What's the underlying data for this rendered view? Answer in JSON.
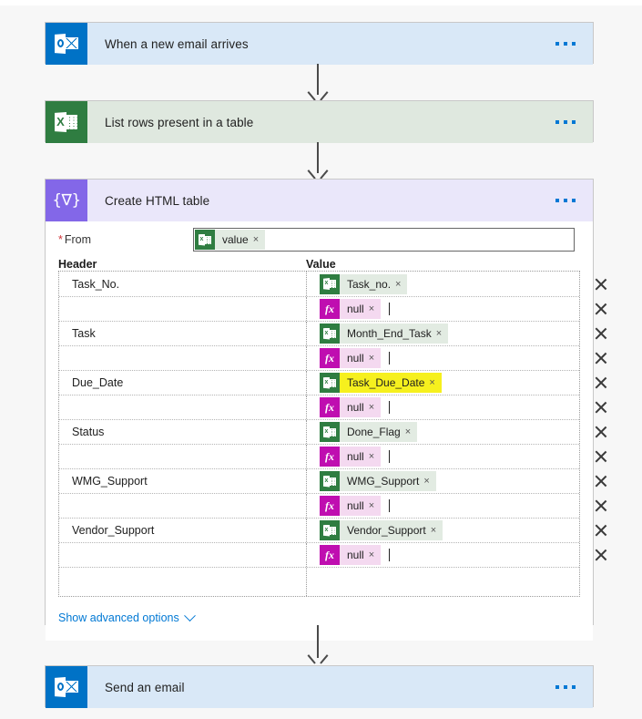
{
  "flow": {
    "steps": [
      {
        "id": "trigger",
        "title": "When a new email arrives",
        "icon": "outlook-icon",
        "theme": "outlook",
        "menu": "more-commands"
      },
      {
        "id": "list-rows",
        "title": "List rows present in a table",
        "icon": "excel-icon",
        "theme": "excel",
        "menu": "more-commands"
      },
      {
        "id": "create-html-table",
        "title": "Create HTML table",
        "icon": "data-operations-icon",
        "theme": "data",
        "menu": "more-commands"
      },
      {
        "id": "send-email",
        "title": "Send an email",
        "icon": "outlook-icon",
        "theme": "outlook",
        "menu": "more-commands"
      }
    ]
  },
  "create_html_table": {
    "from": {
      "label": "From",
      "required_marker": "*",
      "token": {
        "text": "value",
        "type": "excel",
        "remove": "×"
      }
    },
    "columns": {
      "header_label": "Header",
      "value_label": "Value"
    },
    "rows": [
      {
        "header": "Task_No.",
        "value": "Task_no.",
        "token_type": "excel",
        "highlighted": false,
        "remove": "×",
        "delete": "delete-row"
      },
      {
        "header": "",
        "value": "null",
        "token_type": "fx",
        "highlighted": false,
        "remove": "×",
        "delete": "delete-row"
      },
      {
        "header": "Task",
        "value": "Month_End_Task",
        "token_type": "excel",
        "highlighted": false,
        "remove": "×",
        "delete": "delete-row"
      },
      {
        "header": "",
        "value": "null",
        "token_type": "fx",
        "highlighted": false,
        "remove": "×",
        "delete": "delete-row"
      },
      {
        "header": "Due_Date",
        "value": "Task_Due_Date",
        "token_type": "excel",
        "highlighted": true,
        "remove": "×",
        "delete": "delete-row"
      },
      {
        "header": "",
        "value": "null",
        "token_type": "fx",
        "highlighted": false,
        "remove": "×",
        "delete": "delete-row"
      },
      {
        "header": "Status",
        "value": "Done_Flag",
        "token_type": "excel",
        "highlighted": false,
        "remove": "×",
        "delete": "delete-row"
      },
      {
        "header": "",
        "value": "null",
        "token_type": "fx",
        "highlighted": false,
        "remove": "×",
        "delete": "delete-row"
      },
      {
        "header": "WMG_Support",
        "value": "WMG_Support",
        "token_type": "excel",
        "highlighted": false,
        "remove": "×",
        "delete": "delete-row"
      },
      {
        "header": "",
        "value": "null",
        "token_type": "fx",
        "highlighted": false,
        "remove": "×",
        "delete": "delete-row"
      },
      {
        "header": "Vendor_Support",
        "value": "Vendor_Support",
        "token_type": "excel",
        "highlighted": false,
        "remove": "×",
        "delete": "delete-row"
      },
      {
        "header": "",
        "value": "null",
        "token_type": "fx",
        "highlighted": false,
        "remove": "×",
        "delete": "delete-row"
      },
      {
        "header": "",
        "value": "",
        "token_type": "none",
        "highlighted": false,
        "remove": "",
        "delete": ""
      }
    ],
    "advanced": {
      "label": "Show advanced options",
      "chevron": "chevron-down-icon"
    }
  },
  "icons": {
    "data_operations_glyph": "{∇}",
    "fx_glyph": "fx"
  },
  "colors": {
    "page_background": "#f7f7f7",
    "outlook_accent": "#0072c6",
    "outlook_card": "#d9e8f7",
    "excel_accent": "#2f7d41",
    "excel_card": "#dfe8df",
    "data_accent": "#8367e8",
    "data_card": "#eae7fa",
    "link": "#0078d4",
    "highlight": "#f6f01e",
    "token_excel_bg": "#e2ebe2",
    "token_fx_bg": "#f4d9f0",
    "token_fx_accent": "#bf0eb0",
    "required_star": "#d13438",
    "connector": "#4a4a4a"
  }
}
